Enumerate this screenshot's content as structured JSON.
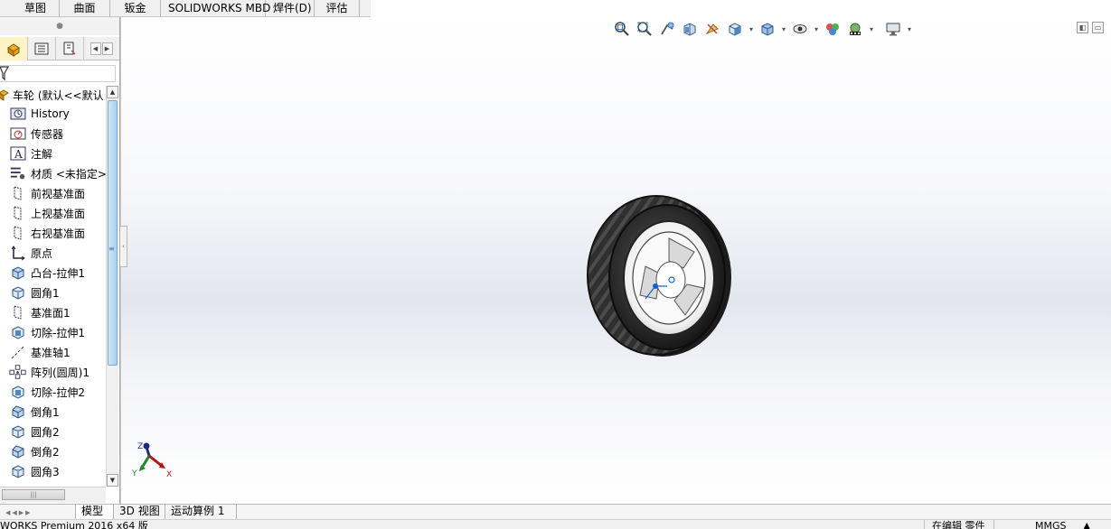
{
  "ribbon_tabs": [
    "草图",
    "曲面",
    "钣金",
    "SOLIDWORKS MBD",
    "焊件(D)",
    "评估"
  ],
  "toolbar_icons": [
    "zoom-to-fit-icon",
    "zoom-to-area-icon",
    "previous-view-icon",
    "section-view-icon",
    "dynamic-annotation-icon",
    "view-orientation-icon",
    "display-style-icon",
    "hide-show-items-icon",
    "edit-appearance-icon",
    "apply-scene-icon",
    "view-settings-icon"
  ],
  "panel": {
    "tabs": [
      "feature-manager-tab",
      "property-manager-tab",
      "configuration-manager-tab"
    ],
    "root_label": "车轮 (默认<<默认",
    "tree": [
      {
        "label": "History",
        "icon": "history-icon"
      },
      {
        "label": "传感器",
        "icon": "sensor-icon"
      },
      {
        "label": "注解",
        "icon": "annotation-icon"
      },
      {
        "label": "材质 <未指定>",
        "icon": "material-icon"
      },
      {
        "label": "前视基准面",
        "icon": "plane-icon"
      },
      {
        "label": "上视基准面",
        "icon": "plane-icon"
      },
      {
        "label": "右视基准面",
        "icon": "plane-icon"
      },
      {
        "label": "原点",
        "icon": "origin-icon"
      },
      {
        "label": "凸台-拉伸1",
        "icon": "boss-extrude-icon"
      },
      {
        "label": "圆角1",
        "icon": "fillet-icon"
      },
      {
        "label": "基准面1",
        "icon": "plane-icon"
      },
      {
        "label": "切除-拉伸1",
        "icon": "cut-extrude-icon"
      },
      {
        "label": "基准轴1",
        "icon": "axis-icon"
      },
      {
        "label": "阵列(圆周)1",
        "icon": "circular-pattern-icon"
      },
      {
        "label": "切除-拉伸2",
        "icon": "cut-extrude-icon"
      },
      {
        "label": "倒角1",
        "icon": "chamfer-icon"
      },
      {
        "label": "圆角2",
        "icon": "fillet-icon"
      },
      {
        "label": "倒角2",
        "icon": "chamfer-icon"
      },
      {
        "label": "圆角3",
        "icon": "fillet-icon"
      }
    ]
  },
  "bottom_tabs": [
    "模型",
    "3D 视图",
    "运动算例 1"
  ],
  "status": {
    "left": "WORKS Premium 2016 x64 版",
    "editing": "在编辑 零件",
    "units": "MMGS"
  },
  "triad": {
    "x": "X",
    "y": "Y",
    "z": "Z"
  },
  "colors": {
    "tire": "#2b2b2b",
    "rim": "#f2f2f2",
    "accent_blue": "#1060d0"
  }
}
